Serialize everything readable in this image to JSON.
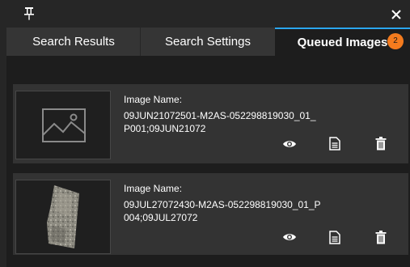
{
  "header": {
    "pin_icon": "pin-icon",
    "close_icon": "close-icon"
  },
  "tabs": [
    {
      "label": "Search Results",
      "active": false
    },
    {
      "label": "Search Settings",
      "active": false
    },
    {
      "label": "Queued Images",
      "active": true,
      "badge": "2"
    }
  ],
  "colors": {
    "accent": "#2aa6ee",
    "badge": "#f47b1e",
    "background": "#262626",
    "panel": "#1d1d1d",
    "card": "#333333"
  },
  "queue": [
    {
      "label": "Image Name:",
      "name": "09JUN21072501-M2AS-052298819030_01_P001;09JUN21072",
      "thumbnail": "image-placeholder-icon",
      "actions": [
        "eye-icon",
        "document-icon",
        "trash-icon"
      ]
    },
    {
      "label": "Image Name:",
      "name": "09JUL27072430-M2AS-052298819030_01_P004;09JUL27072",
      "thumbnail": "satellite-image-thumbnail",
      "actions": [
        "eye-icon",
        "document-icon",
        "trash-icon"
      ]
    }
  ]
}
